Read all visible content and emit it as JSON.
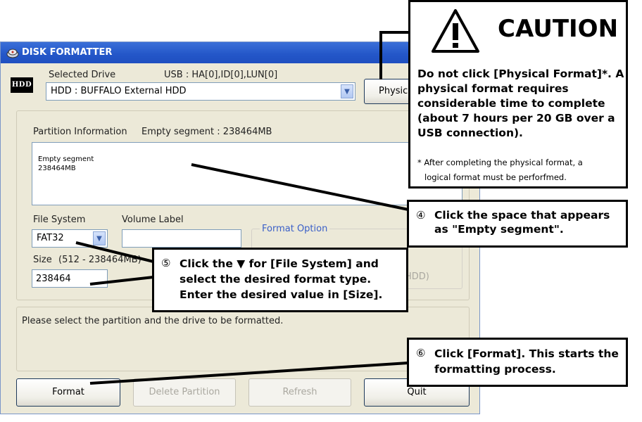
{
  "window": {
    "title": "DISK FORMATTER",
    "hdd_badge": "HDD",
    "selected_drive_label": "Selected Drive",
    "usb_info": "USB : HA[0],ID[0],LUN[0]",
    "drive_value": "HDD : BUFFALO External HDD",
    "physical_button": "Physic",
    "partition_info_label": "Partition Information",
    "partition_info_value": "Empty segment : 238464MB",
    "partition_entry": {
      "name": "Empty segment",
      "size": "238464MB"
    },
    "file_system_label": "File System",
    "file_system_value": "FAT32",
    "volume_label_label": "Volume Label",
    "volume_label_value": "",
    "format_option_label": "Format Option",
    "size_label": "Size",
    "size_range": "(512 - 238464MB)",
    "size_value": "238464",
    "hdd_partial": "HDD)",
    "status_message": "Please select the partition and the drive to be formatted.",
    "buttons": {
      "format": "Format",
      "delete_partition": "Delete Partition",
      "refresh": "Refresh",
      "quit": "Quit"
    }
  },
  "caution": {
    "title": "CAUTION",
    "body": "Do not click [Physical Format]*. A physical format requires considerable time to complete (about 7 hours per 20 GB over a USB connection).",
    "note_line1": "* After completing the physical format, a",
    "note_line2": "logical format must be perforfmed."
  },
  "callouts": {
    "c4_num": "④",
    "c4_text": "Click the space that appears as \"Empty segment\".",
    "c5_num": "⑤",
    "c5_text": "Click the ▼ for [File System] and select the desired format type. Enter the desired value in [Size].",
    "c6_num": "⑥",
    "c6_text": "Click [Format]. This starts the formatting process."
  },
  "icons": [
    "disk-formatter-app-icon",
    "warning-triangle-icon",
    "dropdown-arrow-icon"
  ],
  "colors": {
    "titlebar": "#2356c8",
    "window_bg": "#ece9d8",
    "format_option_text": "#3a5fc8"
  }
}
